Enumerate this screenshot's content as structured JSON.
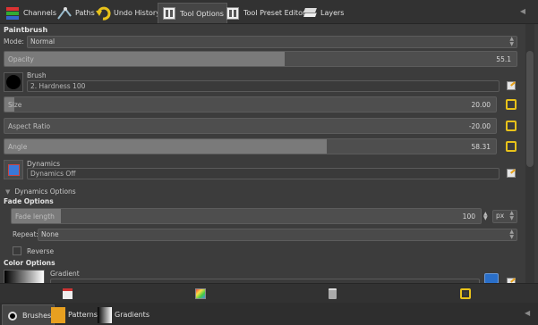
{
  "top_tabs": [
    {
      "label": "Channels",
      "icon": "channels-icon"
    },
    {
      "label": "Paths",
      "icon": "paths-icon"
    },
    {
      "label": "Undo History",
      "icon": "undo-history-icon"
    },
    {
      "label": "Tool Options",
      "icon": "tool-options-icon",
      "active": true
    },
    {
      "label": "Tool Preset Editor",
      "icon": "tool-preset-editor-icon"
    },
    {
      "label": "Layers",
      "icon": "layers-icon"
    }
  ],
  "tool": {
    "title": "Paintbrush"
  },
  "mode": {
    "label": "Mode:",
    "value": "Normal"
  },
  "opacity": {
    "label": "Opacity",
    "value": "55.1",
    "fraction": 0.551
  },
  "brush": {
    "label": "Brush",
    "value": "2. Hardness 100"
  },
  "size": {
    "label": "Size",
    "value": "20.00",
    "fraction": 0.02
  },
  "aspect_ratio": {
    "label": "Aspect Ratio",
    "value": "-20.00",
    "fraction": 0.0
  },
  "angle": {
    "label": "Angle",
    "value": "58.31",
    "fraction": 0.66
  },
  "dynamics": {
    "label": "Dynamics",
    "value": "Dynamics Off"
  },
  "dynamics_options": {
    "label": "Dynamics Options"
  },
  "fade_options": {
    "title": "Fade Options",
    "fade_length": {
      "label": "Fade length",
      "value": "100",
      "unit": "px",
      "fraction": 0.11
    },
    "repeat": {
      "label": "Repeat:",
      "value": "None"
    },
    "reverse": {
      "label": "Reverse",
      "checked": false
    }
  },
  "color_options": {
    "title": "Color Options",
    "gradient": {
      "label": "Gradient"
    }
  },
  "bottom_tabs": [
    {
      "label": "Brushes",
      "icon": "brushes-icon",
      "active": true
    },
    {
      "label": "Patterns",
      "icon": "patterns-icon"
    },
    {
      "label": "Gradients",
      "icon": "gradients-icon"
    }
  ],
  "colors": {
    "accent": "#e8c21a",
    "panel": "#3c3c3c"
  }
}
